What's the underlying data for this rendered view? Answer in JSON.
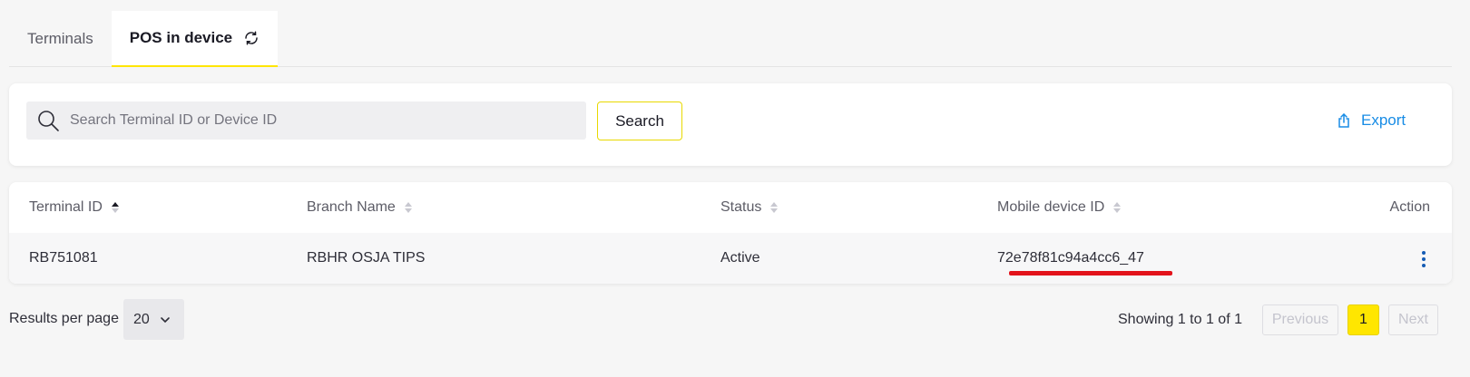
{
  "tabs": [
    {
      "label": "Terminals",
      "active": false
    },
    {
      "label": "POS in device",
      "active": true
    }
  ],
  "search": {
    "placeholder": "Search Terminal ID or Device ID",
    "value": "",
    "button_label": "Search"
  },
  "export": {
    "label": "Export"
  },
  "table": {
    "columns": [
      {
        "label": "Terminal ID",
        "sort": "asc"
      },
      {
        "label": "Branch Name",
        "sort": "none"
      },
      {
        "label": "Status",
        "sort": "none"
      },
      {
        "label": "Mobile device ID",
        "sort": "none"
      },
      {
        "label": "Action"
      }
    ],
    "rows": [
      {
        "terminal_id": "RB751081",
        "branch_name": "RBHR OSJA TIPS",
        "status": "Active",
        "mobile_device_id": "72e78f81c94a4cc6_47"
      }
    ]
  },
  "footer": {
    "results_per_page_label": "Results per page",
    "results_per_page_value": "20",
    "showing_text": "Showing 1 to 1 of 1",
    "pagination": {
      "previous": "Previous",
      "current": "1",
      "next": "Next"
    }
  },
  "colors": {
    "accent": "#ffe600",
    "link": "#188ce5",
    "highlight_underline": "#e3131b"
  },
  "icons": {
    "refresh": "refresh-icon",
    "search": "search-icon",
    "export": "upload-icon",
    "sort": "sort-icon",
    "action": "kebab-icon",
    "dropdown": "chevron-down-icon"
  }
}
